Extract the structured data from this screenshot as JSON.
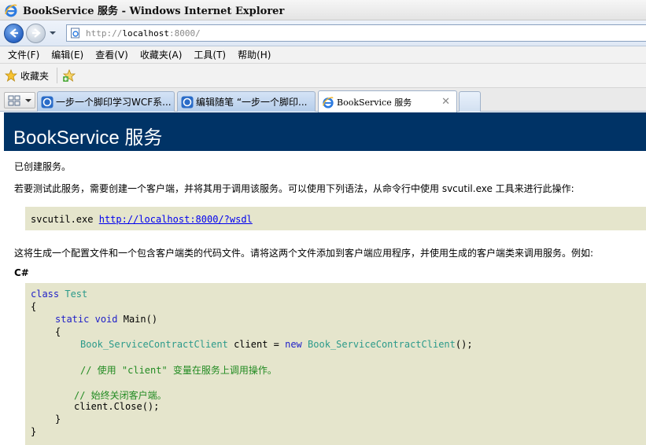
{
  "window": {
    "title": "BookService 服务 - Windows Internet Explorer"
  },
  "address": {
    "url_prefix": "http://",
    "url_host": "localhost",
    "url_suffix": ":8000/"
  },
  "menu": [
    "文件(F)",
    "编辑(E)",
    "查看(V)",
    "收藏夹(A)",
    "工具(T)",
    "帮助(H)"
  ],
  "favorites": {
    "label": "收藏夹"
  },
  "tabs": [
    {
      "label": "一步一个脚印学习WCF系...",
      "active": false
    },
    {
      "label": "编辑随笔 “一步一个脚印...",
      "active": false
    },
    {
      "label": "BookService 服务",
      "active": true
    }
  ],
  "tab_close": "✕",
  "page": {
    "heading": "BookService 服务",
    "created": "已创建服务。",
    "instructions": "若要测试此服务，需要创建一个客户端，并将其用于调用该服务。可以使用下列语法，从命令行中使用 svcutil.exe 工具来进行此操作:",
    "command": "svcutil.exe",
    "command_link": "http://localhost:8000/?wsdl",
    "generate_note": "这将生成一个配置文件和一个包含客户端类的代码文件。请将这两个文件添加到客户端应用程序，并使用生成的客户端类来调用服务。例如:",
    "lang_label": "C#",
    "code": {
      "l1_kw": "class",
      "l1_ty": "Test",
      "l2": "{",
      "l3_kw1": "static",
      "l3_kw2": "void",
      "l3_rest": "Main()",
      "l4": "{",
      "l5_ty1": "Book_ServiceContractClient",
      "l5_mid": "client =",
      "l5_kw": "new",
      "l5_ty2": "Book_ServiceContractClient",
      "l5_end": "();",
      "l6": "// 使用 \"client\" 变量在服务上调用操作。",
      "l7": "// 始终关闭客户端。",
      "l8": "client.Close();",
      "l9": "}",
      "l10": "}"
    }
  },
  "colors": {
    "heading_bg": "#003366",
    "code_bg": "#e5e5cc",
    "keyword": "#1e1ec8",
    "type": "#2b9a8a",
    "comment": "#228b22"
  }
}
